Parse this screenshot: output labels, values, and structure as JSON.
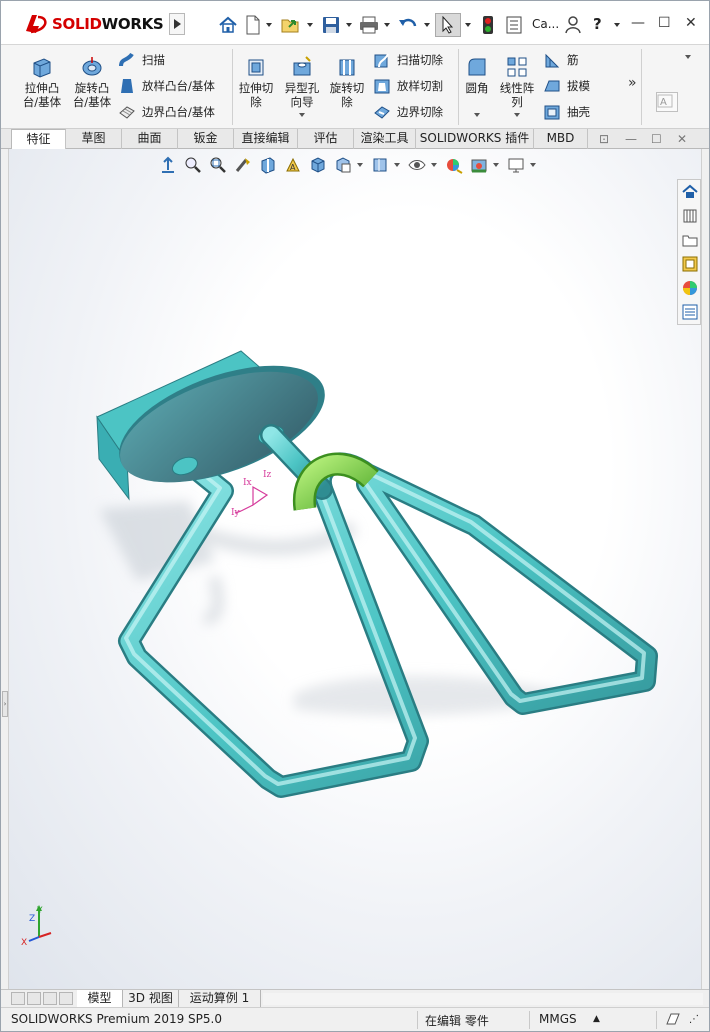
{
  "app": {
    "brand_prefix": "3DS",
    "brand_name": "SOLIDWORKS",
    "brand_parts": [
      "SOLID",
      "WORKS"
    ]
  },
  "quick_access": {
    "items": [
      "home-icon",
      "new-document-icon",
      "open-icon",
      "save-icon",
      "print-icon",
      "undo-icon",
      "select-cursor-icon",
      "rebuild-traffic-light-icon",
      "file-properties-icon",
      "user-icon",
      "help-icon"
    ],
    "user_label": "Ca...",
    "help_label": "?"
  },
  "window_controls": {
    "minimize": "—",
    "maximize": "☐",
    "close": "✕"
  },
  "ribbon": {
    "extrude_boss": {
      "line1": "拉伸凸",
      "line2": "台/基体"
    },
    "revolve_boss": {
      "line1": "旋转凸",
      "line2": "台/基体"
    },
    "sweep": "扫描",
    "loft_boss": "放样凸台/基体",
    "boundary_boss": "边界凸台/基体",
    "extrude_cut": {
      "line1": "拉伸切",
      "line2": "除"
    },
    "hole_wizard": {
      "line1": "异型孔",
      "line2": "向导"
    },
    "revolve_cut": {
      "line1": "旋转切",
      "line2": "除"
    },
    "swept_cut": "扫描切除",
    "lofted_cut": "放样切割",
    "boundary_cut": "边界切除",
    "fillet": "圆角",
    "linear_pattern": {
      "line1": "线性阵",
      "line2": "列"
    },
    "rib": "筋",
    "draft": "拔模",
    "shell": "抽壳",
    "more": "»"
  },
  "command_tabs": [
    "特征",
    "草图",
    "曲面",
    "钣金",
    "直接编辑",
    "评估",
    "渲染工具",
    "SOLIDWORKS 插件",
    "MBD"
  ],
  "active_tab": "特征",
  "heads_up_toolbar": [
    "view-orientation-icon",
    "zoom-to-fit-icon",
    "zoom-to-area-icon",
    "previous-view-icon",
    "section-view-icon",
    "dynamic-annotation-icon",
    "view-orientation-cube-icon",
    "display-style-icon",
    "hide-show-items-icon",
    "edit-appearance-icon",
    "apply-scene-icon",
    "view-settings-icon"
  ],
  "task_pane": [
    "solidworks-resources-icon",
    "design-library-icon",
    "file-explorer-icon",
    "view-palette-icon",
    "appearances-scenes-icon",
    "custom-properties-icon"
  ],
  "model": {
    "colors": {
      "body": "#4cc4c4",
      "flange": "#3f8f98",
      "highlight": "#66cc33",
      "ground_shadow": "#d8dde4"
    },
    "triad_labels": {
      "x": "Ix",
      "y": "Iy",
      "z": "Iz"
    }
  },
  "axis_triad": {
    "x": "X",
    "y": "Y",
    "z": "Z"
  },
  "model_tabs": [
    "模型",
    "3D 视图",
    "运动算例 1"
  ],
  "active_model_tab": "模型",
  "status_bar": {
    "product": "SOLIDWORKS Premium 2019 SP5.0",
    "mode": "在编辑 零件",
    "units": "MMGS",
    "units_caret": "▲"
  }
}
